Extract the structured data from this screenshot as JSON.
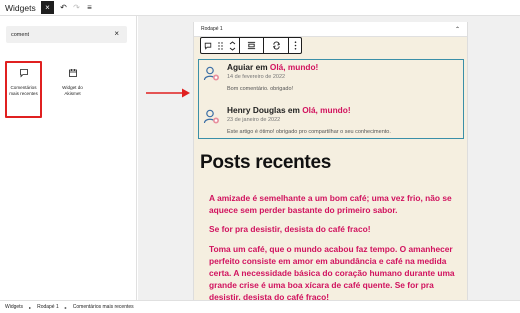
{
  "topbar": {
    "title": "Widgets",
    "close_icon": "×",
    "undo_icon": "↶",
    "redo_icon": "↷",
    "list_view_icon": "≡"
  },
  "inserter": {
    "search_value": "coment",
    "clear_icon": "×",
    "blocks": [
      {
        "label_line1": "Comentários",
        "label_line2": "mais recentes"
      },
      {
        "label_line1": "Widget do",
        "label_line2": "Akismet"
      }
    ]
  },
  "widget_area": {
    "title": "Rodapé 1",
    "toggle_icon": "⌃"
  },
  "block_toolbar": {
    "icons": [
      "comment-icon",
      "drag-handle-icon",
      "move-arrows-icon",
      "align-icon",
      "transform-icon",
      "more-options-icon"
    ]
  },
  "comments": [
    {
      "author": "Aguiar",
      "connector": "em",
      "post": "Olá, mundo!",
      "date": "14 de fevereiro de 2022",
      "text": "Bom comentário. obrigado!"
    },
    {
      "author": "Henry Douglas",
      "connector": "em",
      "post": "Olá, mundo!",
      "date": "23 de janeiro de 2022",
      "text": "Este artigo é ótimo! obrigado pro compartilhar o seu conhecimento."
    }
  ],
  "posts": {
    "heading": "Posts recentes",
    "items": [
      "A amizade é semelhante a um bom café; uma vez frio, não se aquece sem perder bastante do primeiro sabor.",
      "Se for pra desistir, desista do café fraco!",
      "Toma um café, que o mundo acabou faz tempo. O amanhecer perfeito consiste em amor em abundância e café na medida certa. A necessidade básica do coração humano durante uma grande crise é uma boa xícara de café quente. Se for pra desistir, desista do café fraco!"
    ]
  },
  "breadcrumb": [
    "Widgets",
    "Rodapé 1",
    "Comentários mais recentes"
  ],
  "colors": {
    "accent_link": "#d1125e",
    "selection_border": "#3a8fa8",
    "highlight": "#e02020",
    "area_bg": "#f5efe0"
  }
}
